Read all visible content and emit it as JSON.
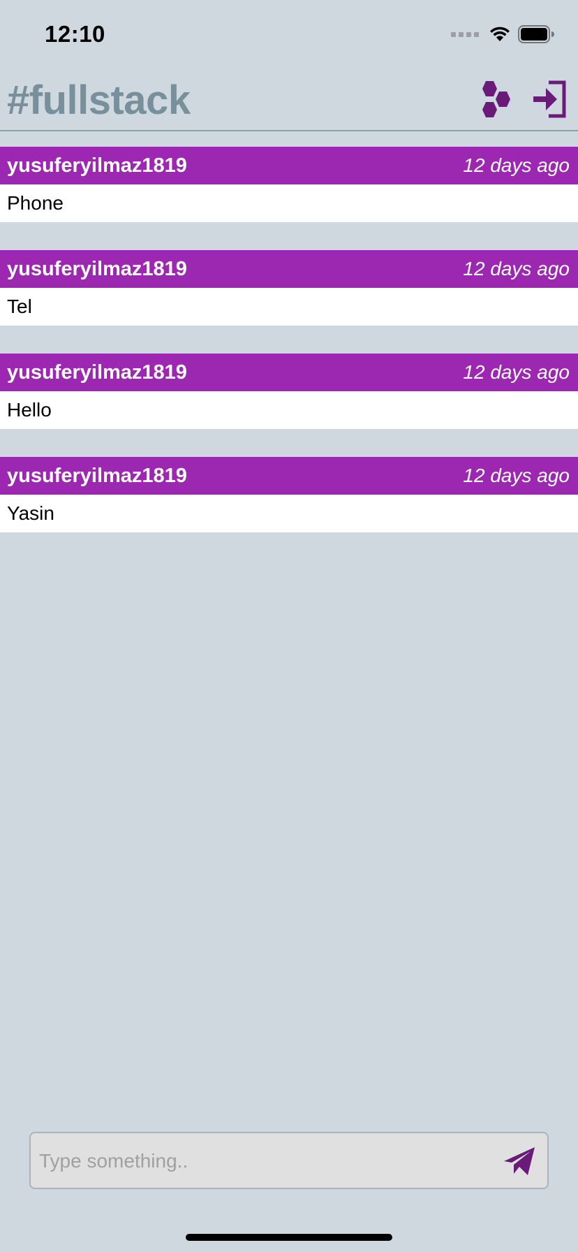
{
  "status_bar": {
    "time": "12:10"
  },
  "header": {
    "title": "#fullstack",
    "icons": [
      "hexagons-icon",
      "login-icon"
    ]
  },
  "messages": [
    {
      "user": "yusuferyilmaz1819",
      "time": "12 days ago",
      "text": "Phone"
    },
    {
      "user": "yusuferyilmaz1819",
      "time": "12 days ago",
      "text": "Tel"
    },
    {
      "user": "yusuferyilmaz1819",
      "time": "12 days ago",
      "text": "Hello"
    },
    {
      "user": "yusuferyilmaz1819",
      "time": "12 days ago",
      "text": "Yasin"
    }
  ],
  "composer": {
    "placeholder": "Type something..",
    "value": ""
  },
  "colors": {
    "background": "#cfd8df",
    "accent": "#9c27b0",
    "icon": "#6a1b7a",
    "title": "#78909c"
  }
}
